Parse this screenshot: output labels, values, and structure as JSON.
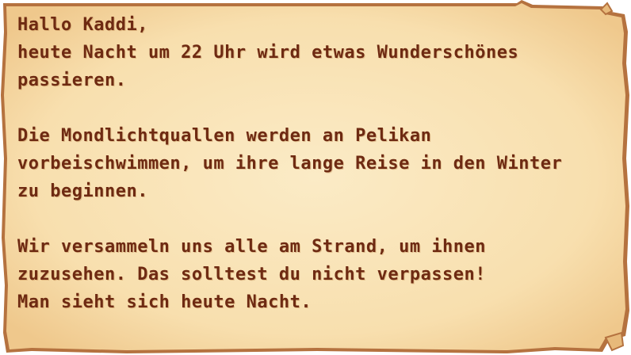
{
  "letter": {
    "paragraphs": [
      [
        "Hallo Kaddi,",
        "heute Nacht um 22 Uhr wird etwas Wunderschönes",
        "passieren."
      ],
      [
        "Die Mondlichtquallen werden an Pelikan",
        "vorbeischwimmen, um ihre lange Reise in den Winter",
        "zu beginnen."
      ],
      [
        "Wir versammeln uns alle am Strand, um ihnen",
        "zuzusehen. Das solltest du nicht verpassen!",
        "Man sieht sich heute Nacht."
      ]
    ]
  },
  "colors": {
    "paper": "#f9e3b4",
    "paper_edge": "#e7b97a",
    "border": "#b5723f",
    "text": "#6e2a12"
  }
}
